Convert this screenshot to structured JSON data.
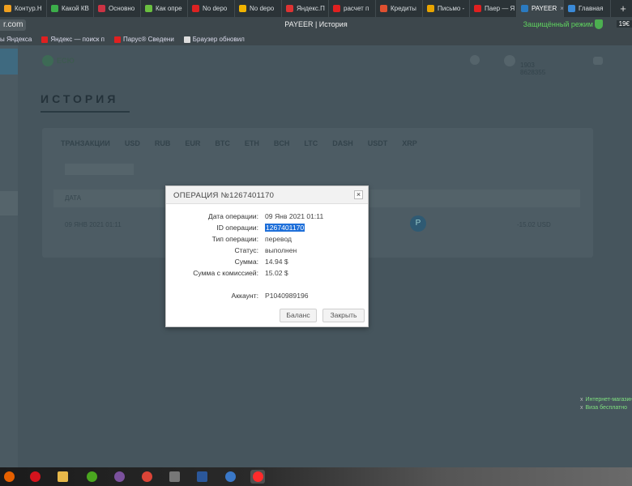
{
  "browser": {
    "tabs": [
      {
        "label": "Контур.Н",
        "icon_color": "#f0a020",
        "active": false
      },
      {
        "label": "Какой КВ",
        "icon_color": "#3cae4a",
        "active": false
      },
      {
        "label": "Основно",
        "icon_color": "#cc3344",
        "active": false
      },
      {
        "label": "Как опре",
        "icon_color": "#6abf40",
        "active": false
      },
      {
        "label": "No depo",
        "icon_color": "#dd2222",
        "active": false
      },
      {
        "label": "No depo",
        "icon_color": "#f1b400",
        "active": false
      },
      {
        "label": "Яндекс.П",
        "icon_color": "#d33",
        "active": false
      },
      {
        "label": "расчет п",
        "icon_color": "#e02020",
        "active": false
      },
      {
        "label": "Кредиты",
        "icon_color": "#e05030",
        "active": false
      },
      {
        "label": "Письмо -",
        "icon_color": "#e8a400",
        "active": false
      },
      {
        "label": "Паер — Я",
        "icon_color": "#e02020",
        "active": false
      },
      {
        "label": "PAYEER",
        "icon_color": "#2a7ac0",
        "active": true
      },
      {
        "label": "Главная",
        "icon_color": "#3a8ad8",
        "active": false
      }
    ],
    "tab_close_glyph": "×",
    "new_tab_glyph": "+",
    "url_fragment": "r.com",
    "page_title": "PAYEER | История",
    "secure_label": "Защищённый режим",
    "counter": "19€",
    "bookmarks": [
      {
        "label": "ы Яндекса",
        "icon_color": ""
      },
      {
        "label": "Яндекс — поиск п",
        "icon_color": "#e02020"
      },
      {
        "label": "Парус® Сведени",
        "icon_color": "#e02020"
      },
      {
        "label": "Браузер обновил",
        "icon_color": "#dddddd"
      }
    ]
  },
  "background_page": {
    "heading": "ИСТОРИЯ",
    "logo": "ЕСЮ",
    "user_number": "1903 8628355",
    "tabs": [
      "ТРАНЗАКЦИИ",
      "USD",
      "RUB",
      "EUR",
      "BTC",
      "ETH",
      "BCH",
      "LTC",
      "DASH",
      "USDT",
      "XRP"
    ],
    "table_header": "ДАТА",
    "row_date": "09 ЯНВ 2021 01:11",
    "row_amount": "-15.02 USD",
    "row_badge": "P"
  },
  "modal": {
    "title": "ОПЕРАЦИЯ №1267401170",
    "close_glyph": "×",
    "fields": [
      {
        "label": "Дата операции:",
        "value": "09 Янв 2021 01:11"
      },
      {
        "label": "ID операции:",
        "value": "1267401170",
        "selected": true
      },
      {
        "label": "Тип операции:",
        "value": "перевод"
      },
      {
        "label": "Статус:",
        "value": "выполнен"
      },
      {
        "label": "Сумма:",
        "value": "14.94 $"
      },
      {
        "label": "Сумма с комиссией:",
        "value": "15.02 $"
      }
    ],
    "account": {
      "label": "Аккаунт:",
      "value": "P1040989196"
    },
    "balance_button": "Баланс",
    "close_button": "Закрыть"
  },
  "side_links": [
    {
      "prefix": "x",
      "label": "Интернет-магазин"
    },
    {
      "prefix": "x",
      "label": "Виза бесплатно"
    }
  ],
  "taskbar": {
    "icons": [
      {
        "name": "firefox-icon",
        "color": "#e66000"
      },
      {
        "name": "opera-icon",
        "color": "#d4131d"
      },
      {
        "name": "file-explorer-icon",
        "color": "#e7b84a"
      },
      {
        "name": "utorrent-icon",
        "color": "#4aa61f"
      },
      {
        "name": "viber-icon",
        "color": "#7b519d"
      },
      {
        "name": "chrome-icon",
        "color": "#db4437"
      },
      {
        "name": "calculator-icon",
        "color": "#777777"
      },
      {
        "name": "word-icon",
        "color": "#2b579a"
      },
      {
        "name": "network-icon",
        "color": "#3a78c8"
      },
      {
        "name": "yandex-browser-icon",
        "color": "#ff2b2b"
      }
    ],
    "active": "yandex-browser-icon"
  }
}
